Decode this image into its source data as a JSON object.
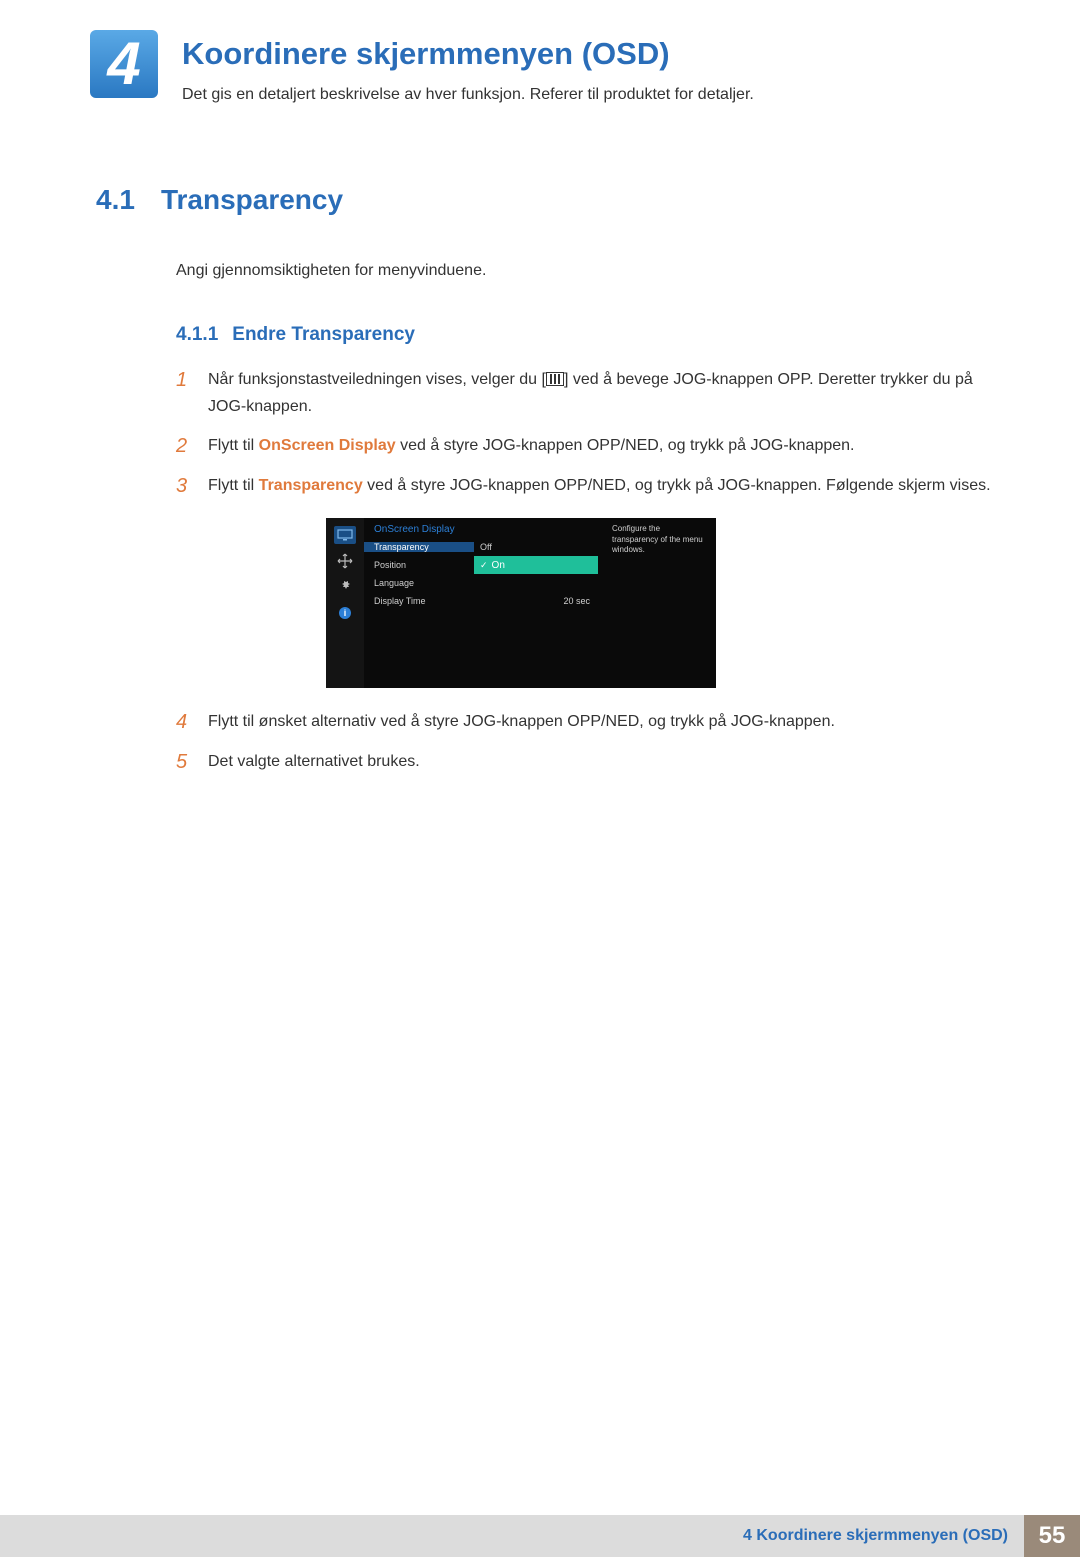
{
  "chapter": {
    "number": "4",
    "title": "Koordinere skjermmenyen (OSD)",
    "description": "Det gis en detaljert beskrivelse av hver funksjon. Referer til produktet for detaljer."
  },
  "section": {
    "number": "4.1",
    "title": "Transparency",
    "description": "Angi gjennomsiktigheten for menyvinduene."
  },
  "subsection": {
    "number": "4.1.1",
    "title": "Endre Transparency"
  },
  "steps": {
    "s1_a": "Når funksjonstastveiledningen vises, velger du [",
    "s1_b": "] ved å bevege JOG-knappen OPP. Deretter trykker du på JOG-knappen.",
    "s2_a": "Flytt til ",
    "s2_kw": "OnScreen Display",
    "s2_b": " ved å styre JOG-knappen OPP/NED, og trykk på JOG-knappen.",
    "s3_a": "Flytt til ",
    "s3_kw": "Transparency",
    "s3_b": " ved å styre JOG-knappen OPP/NED, og trykk på JOG-knappen. Følgende skjerm vises.",
    "s4": "Flytt til ønsket alternativ ved å styre JOG-knappen OPP/NED, og trykk på JOG-knappen.",
    "s5": "Det valgte alternativet brukes.",
    "n1": "1",
    "n2": "2",
    "n3": "3",
    "n4": "4",
    "n5": "5"
  },
  "osd": {
    "title": "OnScreen Display",
    "rows": {
      "transparency": "Transparency",
      "position": "Position",
      "language": "Language",
      "displayTime": "Display Time"
    },
    "values": {
      "off": "Off",
      "on": "On",
      "time": "20 sec"
    },
    "description": "Configure the transparency of the menu windows."
  },
  "footer": {
    "label": "4 Koordinere skjermmenyen (OSD)",
    "page": "55"
  }
}
